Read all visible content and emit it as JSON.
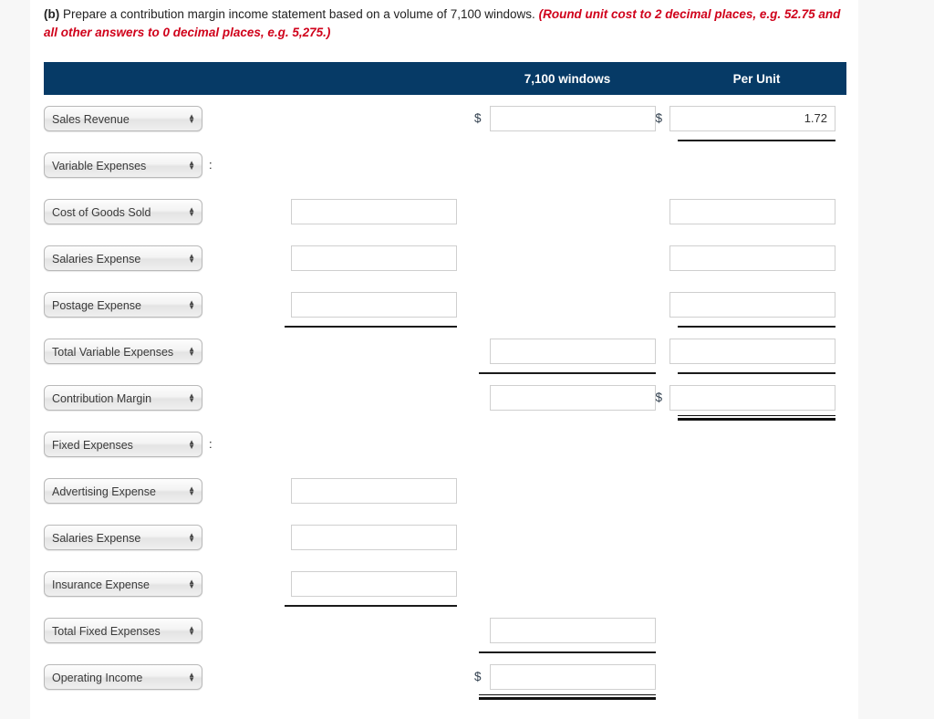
{
  "prompt": {
    "part_label": "(b)",
    "text": "Prepare a contribution margin income statement based on a volume of 7,100 windows.",
    "note": "(Round unit cost to 2 decimal places, e.g. 52.75 and all other answers to 0 decimal places, e.g. 5,275.)"
  },
  "colors": {
    "header_bar": "#063a66",
    "note_red": "#d0021b",
    "rule_black": "#1a1a1a",
    "input_border": "#cfcfcf"
  },
  "table": {
    "headers": {
      "label_col": "",
      "detail_col": "",
      "volume_col": "7,100 windows",
      "per_unit_col": "Per Unit"
    },
    "rows": [
      {
        "account": "Sales Revenue",
        "colon": "",
        "detail_value": "",
        "volume_value": "",
        "volume_dollar": "$",
        "per_unit_value": "1.72",
        "per_unit_dollar": "$"
      },
      {
        "account": "Variable Expenses",
        "colon": ":",
        "detail_value": "",
        "volume_value": "",
        "volume_dollar": "",
        "per_unit_value": "",
        "per_unit_dollar": ""
      },
      {
        "account": "Cost of Goods Sold",
        "colon": "",
        "detail_value": "",
        "volume_value": "",
        "volume_dollar": "",
        "per_unit_value": "",
        "per_unit_dollar": ""
      },
      {
        "account": "Salaries Expense",
        "colon": "",
        "detail_value": "",
        "volume_value": "",
        "volume_dollar": "",
        "per_unit_value": "",
        "per_unit_dollar": ""
      },
      {
        "account": "Postage Expense",
        "colon": "",
        "detail_value": "",
        "volume_value": "",
        "volume_dollar": "",
        "per_unit_value": "",
        "per_unit_dollar": ""
      },
      {
        "account": "Total Variable Expenses",
        "colon": "",
        "detail_value": "",
        "volume_value": "",
        "volume_dollar": "",
        "per_unit_value": "",
        "per_unit_dollar": ""
      },
      {
        "account": "Contribution Margin",
        "colon": "",
        "detail_value": "",
        "volume_value": "",
        "volume_dollar": "",
        "per_unit_value": "",
        "per_unit_dollar": "$"
      },
      {
        "account": "Fixed Expenses",
        "colon": ":",
        "detail_value": "",
        "volume_value": "",
        "volume_dollar": "",
        "per_unit_value": "",
        "per_unit_dollar": ""
      },
      {
        "account": "Advertising Expense",
        "colon": "",
        "detail_value": "",
        "volume_value": "",
        "volume_dollar": "",
        "per_unit_value": "",
        "per_unit_dollar": ""
      },
      {
        "account": "Salaries Expense",
        "colon": "",
        "detail_value": "",
        "volume_value": "",
        "volume_dollar": "",
        "per_unit_value": "",
        "per_unit_dollar": ""
      },
      {
        "account": "Insurance Expense",
        "colon": "",
        "detail_value": "",
        "volume_value": "",
        "volume_dollar": "",
        "per_unit_value": "",
        "per_unit_dollar": ""
      },
      {
        "account": "Total Fixed Expenses",
        "colon": "",
        "detail_value": "",
        "volume_value": "",
        "volume_dollar": "",
        "per_unit_value": "",
        "per_unit_dollar": ""
      },
      {
        "account": "Operating Income",
        "colon": "",
        "detail_value": "",
        "volume_value": "",
        "volume_dollar": "$",
        "per_unit_value": "",
        "per_unit_dollar": ""
      }
    ]
  },
  "icons": {
    "stepper_up": "▲",
    "stepper_down": "▼"
  }
}
